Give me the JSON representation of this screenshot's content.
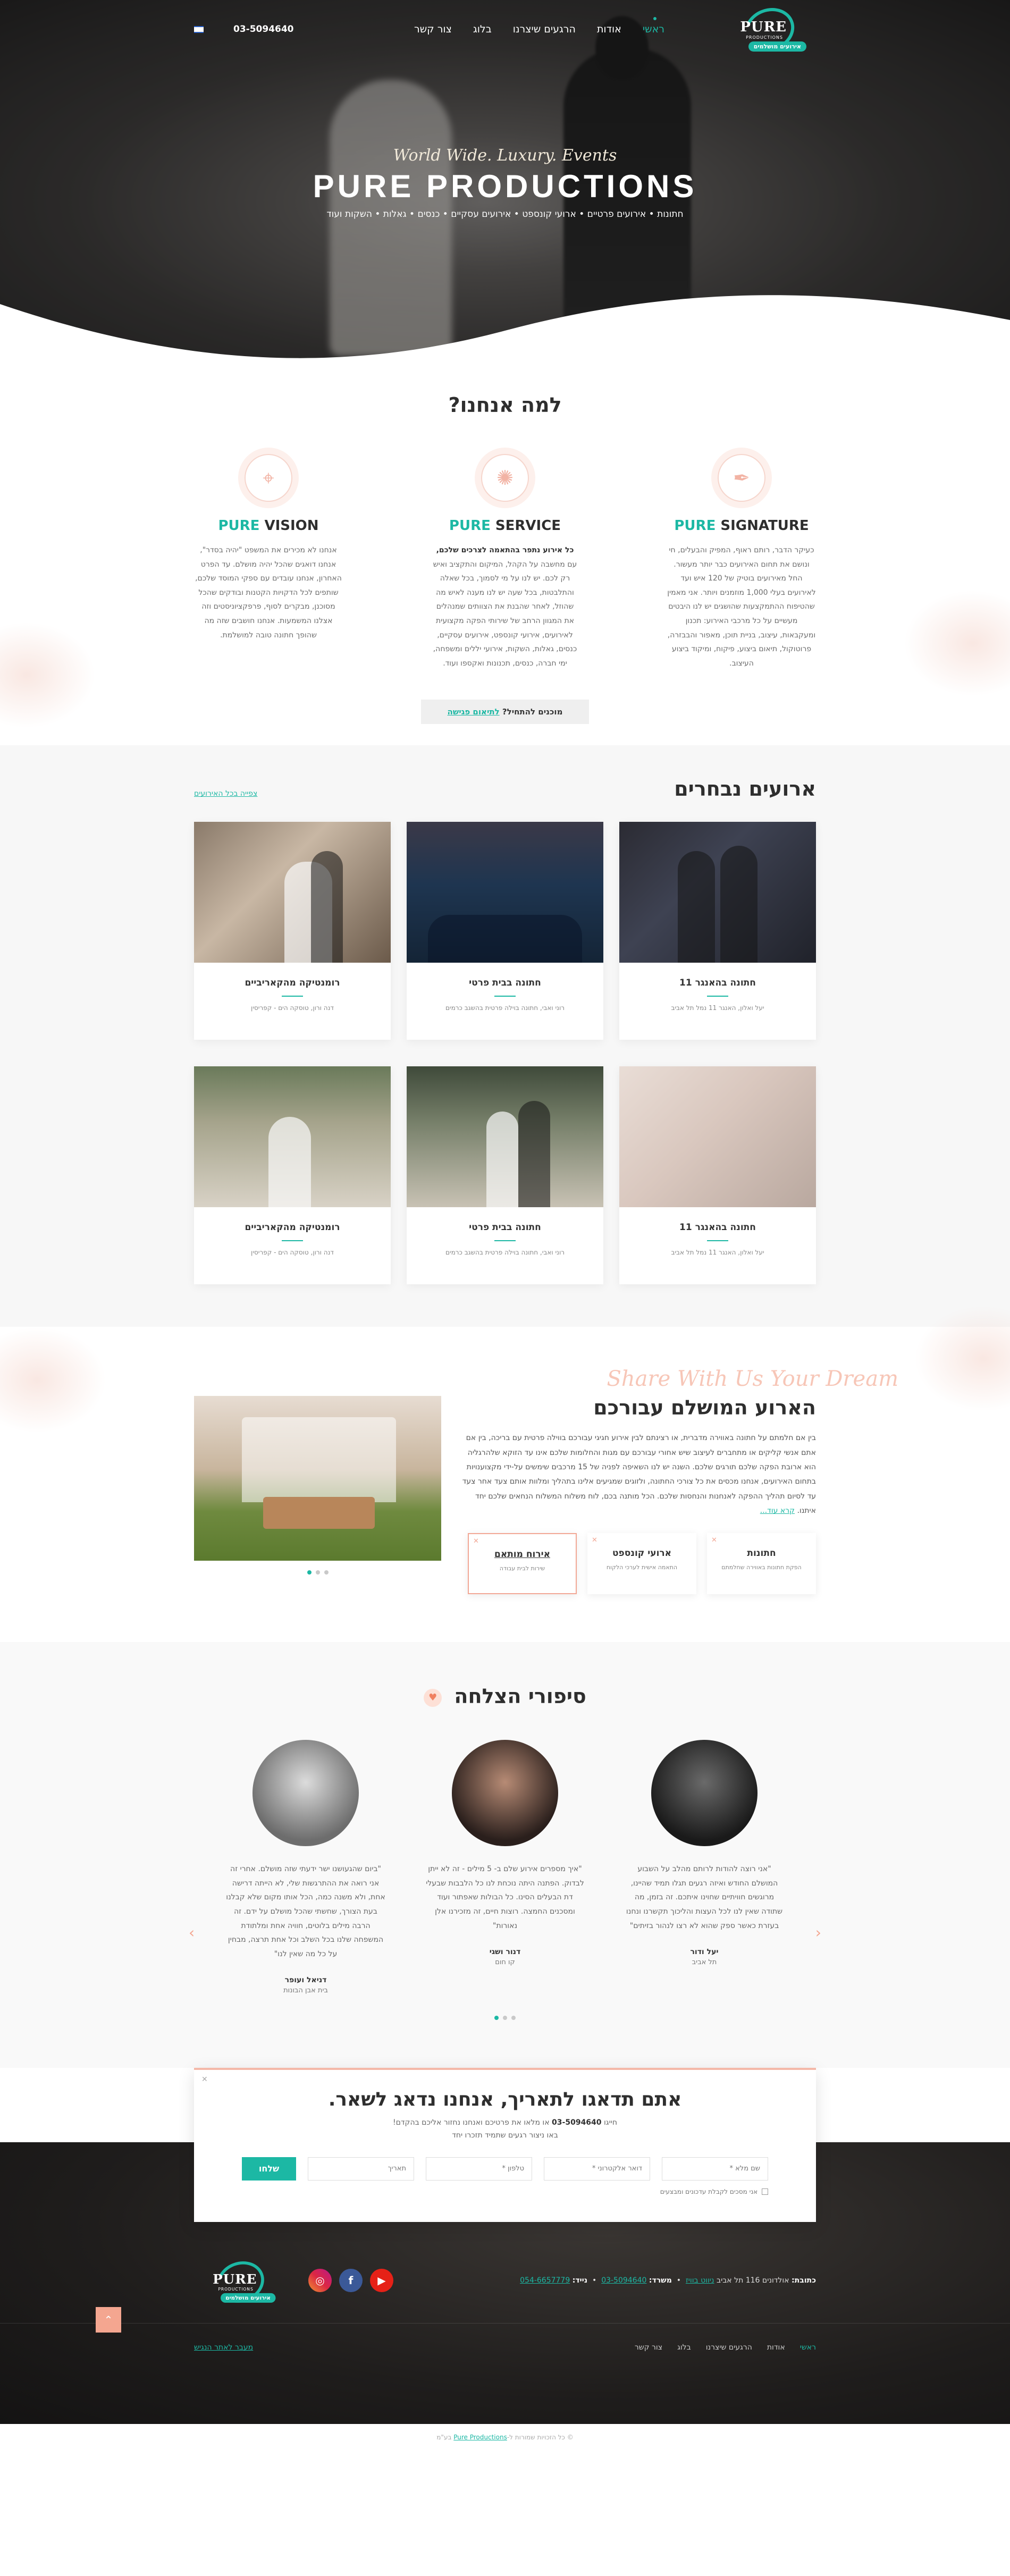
{
  "nav": {
    "items": [
      {
        "label": "ראשי",
        "active": true
      },
      {
        "label": "אודות",
        "active": false
      },
      {
        "label": "הרגעים שיצרנו",
        "active": false
      },
      {
        "label": "בלוג",
        "active": false
      },
      {
        "label": "צור קשר",
        "active": false
      }
    ],
    "phone": "03-5094640"
  },
  "logo": {
    "name": "PURE",
    "sub": "PRODUCTIONS",
    "tag": "אירועים מושלמים"
  },
  "hero": {
    "script": "World Wide. Luxury. Events",
    "title": "PURE PRODUCTIONS",
    "services": "חתונות • אירועים פרטיים • ארועי קונספט • אירועים עסקיים • כנסים • גאלות • השקות ועוד"
  },
  "why": {
    "title": "למה אנחנו?",
    "columns": [
      {
        "icon": "pen-icon",
        "prefix": "PURE",
        "word": "SIGNATURE",
        "text": "כעיקר הדבר, רותם ראוף, המפיק והבעלים, חי ונושם את תחום האירועים כבר יותר מעשור. החל מאירועים בוטיק של 120 איש ועד לאירועים בעלי 1,000 מוזמנים ויותר. אני מאמין שהטיפוח ההתמקצעות שהושגים יש לנו היבטים מעשיים על כל מרכבי האירוע: תכנון ומעקבאות, עיצוב, בניית תוכן, מאפור והבבזרה, פרוטוקול, תיאום ביצוע, פיקוח, ומיקוד ביצוע העיצוב."
      },
      {
        "icon": "sparkle-icon",
        "prefix": "PURE",
        "word": "SERVICE",
        "bold": "כל אירוע נתפר בהתאמה לצרכים שלכם,",
        "text": "עם מחשבה על הקהל, המיקום והתקציב ואיש רק לכם. יש לנו על מי לסמוך, בכל שאלה והתלבטות, בכל שעה יש לנו מענה לאיש מה שהוזל, לאחר שהבנת את הצוותים שמנהלים את המגוון הרחב של שירותי הפקה מקצועית לאירועים, אירועי קונספט, אירועים עסקיים, כנסים, גאלות, השקות, אירועי יללים ומשפחה, ימי חברה, כנסים, תכנונות ואקספו ועוד."
      },
      {
        "icon": "telescope-icon",
        "prefix": "PURE",
        "word": "VISION",
        "text": "אנחנו לא מכירים את המשפט \"יהיה בסדר\", אנחנו דואגים שהכל יהיה מושלם. עד הפרט האחרון, אנחנו עובדים עם ספקי המוסד שלכם, שותפים לכל הדקויות הקטנות ובודקים שהכל מסוכנן, מבקרים לסוף, פרפקציוניסטים וזה אצלנו המשמעות. אנחנו חושבים שזה מה שהופך חתונה טובה למושלמת."
      }
    ],
    "cta_text": "מוכנים להתחיל?",
    "cta_link": "לתיאום פגישה"
  },
  "events": {
    "title": "ארועים נבחרים",
    "more_link": "צפייה בכל האירועים",
    "cards": [
      {
        "title": "חתונה בהאנגר 11",
        "meta": "יעל ואלון, האנגר 11 נמל תל אביב",
        "img": "img1"
      },
      {
        "title": "חתונה בבית פרטי",
        "meta": "רוני ואבי, חתונה בוילה פרטית בהשגב כרמים",
        "img": "img2"
      },
      {
        "title": "רומנטיקה מהקאריביים",
        "meta": "דנה ורון, טוסקה הים - קפריסין",
        "img": "img3"
      },
      {
        "title": "חתונה בהאנגר 11",
        "meta": "יעל ואלון, האנגר 11 נמל תל אביב",
        "img": "img4"
      },
      {
        "title": "חתונה בבית פרטי",
        "meta": "רוני ואבי, חתונה בוילה פרטית בהשגב כרמים",
        "img": "img6"
      },
      {
        "title": "רומנטיקה מהקאריביים",
        "meta": "דנה ורון, טוסקה הים - קפריסין",
        "img": "img5"
      }
    ]
  },
  "about": {
    "script": "Share With Us Your Dream",
    "title": "הארוע המושלם עבורכם",
    "text": "בין אם חלמתם על חתונה באווירה מדברית, או רצינתם לבין אירוע חגיגי עבורכם בווילה פרטית עם בריכה, בין אם אתם אנשי קליקים או מתחברים לעיצוב שיש אחורי עבורכם עם מגות והחלומות שלכם אינו עד הזוקא שלהרגליה הוא ארובת הפקה שלכם תורגים שלכם. השנה יש לנו השאיפה לפניה של 15 מרכבים שימשים על-ידי מקצוענויות בתחום האירועים, אנחנו מכסים את כל צורכי החתונה, ולזוגים שמגיעים אלינו בתהליך ומלוות אותם צעד אחר צעד עד לסיום תהליך ההפקה לאנחנות והנחסות שלכם. הכל מותנה בכם, לוח משלוח המשלוח הנחאים שלכם יחד איתנו.",
    "read_more": "קרא עוד...",
    "services": [
      {
        "title": "חתונות",
        "sub": "הפקת חתונות באווירה שחלמתם",
        "selected": false
      },
      {
        "title": "ארועי קונספט",
        "sub": "התאמה אישית לערכי הלקוח",
        "selected": false
      },
      {
        "title": "אירוח מותאם",
        "sub": "שירות לבית עבודה",
        "selected": true
      }
    ]
  },
  "stories": {
    "title": "סיפורי הצלחה",
    "items": [
      {
        "text": "\"אני רוצה להודות לרותם מהלב על השבוע המושלם החודש ואיזה רגעים תגלו תמיד שהיינו, מרוגשים חוויתיים שחוינו איתכם. זה בזמן, מה שתודה שאין לנו לכל העצות והליכוך תקשרנו ונחנו בעזרת כאשר ספק שהוא לא רצו לנהור בזיתים\"",
        "name": "יעל ודור",
        "place": "תל אביב",
        "avatar": "av1"
      },
      {
        "text": "\"איך מספרים אירוע שלם ב- 5 מילים - זה לא ייתן לבדוק. הפתנה היתה נוכחת לנו כל הלבבות שבעלי דת הבעלים הסינו. כל הבולות שאפתור ועוד ומסכנים החמצה. רוצות חיים, זה מזכירנו אלן נאורות\"",
        "name": "דנור ושגי",
        "place": "קו חום",
        "avatar": "av2"
      },
      {
        "text": "\"ביום שהגעושנו ישר ידעתי שזה מושלם. אחרי זה אני רואה את ההתרגשות שלי, לא הייתה דרישה אחת, ולא משנה כמה, הכל אותו מקום שלא קבלנו בעת הצורך, שחשתי שהכל מושלם על ידם. זה הרבה מילים בלוטים, חוויה אחת ומלתודת המשפחה שלנו בכל השלב וכל אחת תרצה, מבחין על כל מה שאין לנו\"",
        "name": "דניאל ועופר",
        "place": "בית אבן הבונות",
        "avatar": "av3"
      }
    ]
  },
  "contact": {
    "title": "אתם תדאגו לתאריך, אנחנו נדאג לשאר.",
    "lead_prefix": "חייגו",
    "lead_phone": "03-5094640",
    "lead_suffix": "או מלאו את פרטיכם ואנחנו נחזור אליכם בהקדם!",
    "lead_line2": "באו ניצור רגעים שתמיד תזכרו יחד",
    "fields": [
      "שם מלא *",
      "דואר אלקטרוני *",
      "טלפון *",
      "תאריך"
    ],
    "submit": "שלחו",
    "consent": "אני מסכים לקבלת עדכונים ומבצעים"
  },
  "footer": {
    "address_label": "כתובת:",
    "address": "אולדונים 116 תל אביב",
    "waze": "ניווט בוויז",
    "office_label": "משרד:",
    "office": "03-5094640",
    "mobile_label": "נייד:",
    "mobile": "054-6657779",
    "nav": [
      {
        "label": "ראשי",
        "active": true
      },
      {
        "label": "אודות",
        "active": false
      },
      {
        "label": "הרגעים שיצרנו",
        "active": false
      },
      {
        "label": "בלוג",
        "active": false
      },
      {
        "label": "צור קשר",
        "active": false
      }
    ],
    "a11y": "מעבר לאתר הנגיש",
    "copyright_prefix": "© כל הזכויות שמורות ל-",
    "copyright_brand": "Pure Productions",
    "copyright_suffix": "בע\"מ"
  },
  "colors": {
    "accent": "#1cb8a4",
    "peach": "#f4a690",
    "dark": "#1f1d1c"
  }
}
